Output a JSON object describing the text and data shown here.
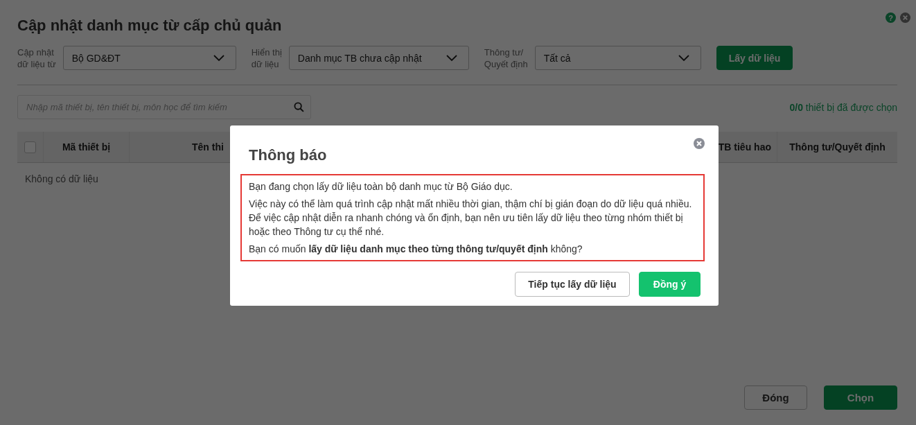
{
  "window": {
    "title": "Cập nhật danh mục từ cấp chủ quản",
    "help": "?"
  },
  "filters": [
    {
      "label": "Cập nhật\ndữ liệu từ",
      "value": "Bộ GD&ĐT"
    },
    {
      "label": "Hiển thị\ndữ liệu",
      "value": "Danh mục TB chưa cập nhật"
    },
    {
      "label": "Thông tư/\nQuyết định",
      "value": "Tất cả"
    }
  ],
  "fetch_button": "Lấy dữ liệu",
  "search": {
    "placeholder": "Nhập mã thiết bị, tên thiết bị, môn học để tìm kiếm"
  },
  "selection_count": "**0/0** thiết bị đã được chọn",
  "table": {
    "select_all_checked": false,
    "columns": [
      "Mã thiết bị",
      "Tên thi",
      "TB tiêu hao",
      "Thông tư/Quyết định"
    ],
    "empty_text": "Không có dữ liệu"
  },
  "footer_buttons": [
    {
      "label": "Đóng",
      "kind": "secondary"
    },
    {
      "label": "Chọn",
      "kind": "primary"
    }
  ],
  "modal": {
    "title": "Thông báo",
    "paragraphs": [
      "Bạn đang chọn lấy dữ liệu toàn bộ danh mục từ Bộ Giáo dục.",
      "Việc này có thể làm quá trình cập nhật mất nhiều thời gian, thậm chí bị gián đoạn do dữ liệu quá nhiều. Để việc cập nhật diễn ra nhanh chóng và ổn định, bạn nên ưu tiên lấy dữ liệu theo từng nhóm thiết bị hoặc theo Thông tư cụ thể nhé.",
      "Bạn có muốn **lấy dữ liệu danh mục theo từng thông tư/quyết định** không?"
    ],
    "buttons": [
      {
        "label": "Tiếp tục lấy dữ liệu",
        "kind": "secondary"
      },
      {
        "label": "Đồng ý",
        "kind": "primary"
      }
    ]
  }
}
